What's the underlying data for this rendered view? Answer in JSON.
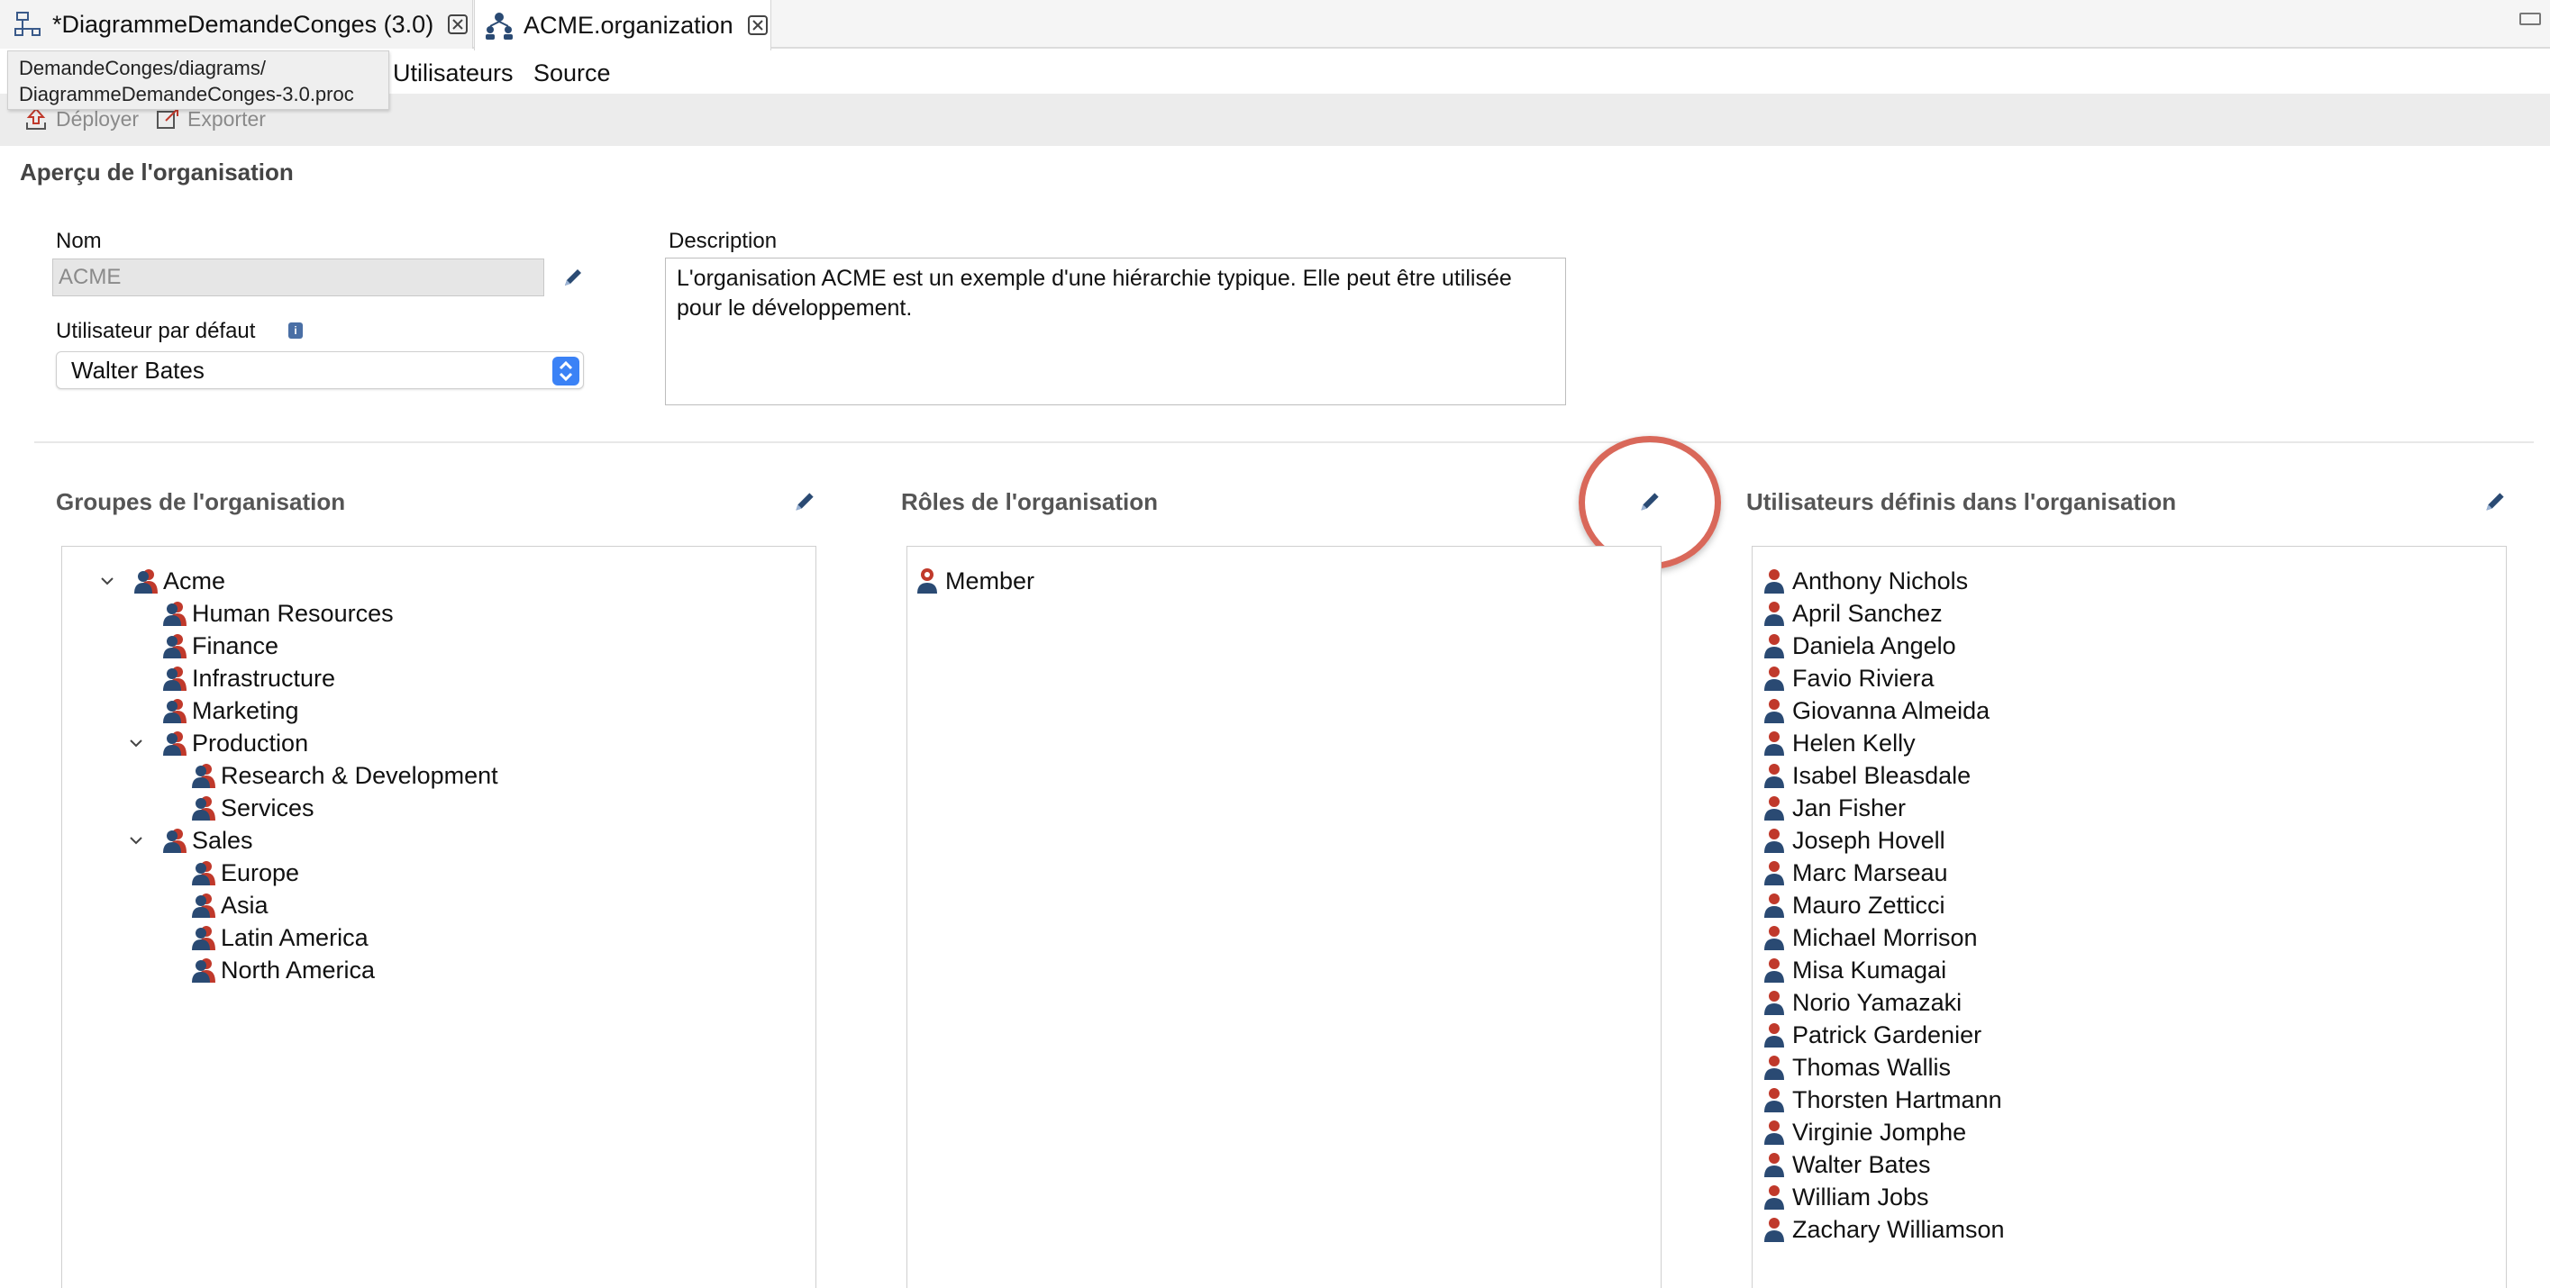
{
  "tabs": [
    {
      "label": "*DiagrammeDemandeConges (3.0)",
      "active": false
    },
    {
      "label": "ACME.organization",
      "active": true
    }
  ],
  "tooltip": {
    "line1": "DemandeConges/diagrams/",
    "line2": "DiagrammeDemandeConges-3.0.proc"
  },
  "subtabs": {
    "users": "Utilisateurs",
    "source": "Source"
  },
  "toolbar": {
    "deploy": "Déployer",
    "export": "Exporter"
  },
  "overview": {
    "title": "Aperçu de l'organisation",
    "name_label": "Nom",
    "name_value": "ACME",
    "default_user_label": "Utilisateur par défaut",
    "default_user_value": "Walter Bates",
    "description_label": "Description",
    "description_value": "L'organisation ACME est un exemple d'une hiérarchie typique. Elle peut être utilisée pour le développement."
  },
  "groups": {
    "title": "Groupes de l'organisation",
    "items": [
      {
        "label": "Acme",
        "level": 0,
        "expandable": true
      },
      {
        "label": "Human Resources",
        "level": 1,
        "expandable": false
      },
      {
        "label": "Finance",
        "level": 1,
        "expandable": false
      },
      {
        "label": "Infrastructure",
        "level": 1,
        "expandable": false
      },
      {
        "label": "Marketing",
        "level": 1,
        "expandable": false
      },
      {
        "label": "Production",
        "level": 1,
        "expandable": true
      },
      {
        "label": "Research & Development",
        "level": 2,
        "expandable": false
      },
      {
        "label": "Services",
        "level": 2,
        "expandable": false
      },
      {
        "label": "Sales",
        "level": 1,
        "expandable": true
      },
      {
        "label": "Europe",
        "level": 2,
        "expandable": false
      },
      {
        "label": "Asia",
        "level": 2,
        "expandable": false
      },
      {
        "label": "Latin America",
        "level": 2,
        "expandable": false
      },
      {
        "label": "North America",
        "level": 2,
        "expandable": false
      }
    ]
  },
  "roles": {
    "title": "Rôles de l'organisation",
    "items": [
      "Member"
    ]
  },
  "users": {
    "title": "Utilisateurs définis dans l'organisation",
    "items": [
      "Anthony Nichols",
      "April Sanchez",
      "Daniela Angelo",
      "Favio Riviera",
      "Giovanna Almeida",
      "Helen Kelly",
      "Isabel Bleasdale",
      "Jan Fisher",
      "Joseph Hovell",
      "Marc Marseau",
      "Mauro Zetticci",
      "Michael Morrison",
      "Misa Kumagai",
      "Norio Yamazaki",
      "Patrick Gardenier",
      "Thomas Wallis",
      "Thorsten Hartmann",
      "Virginie Jomphe",
      "Walter Bates",
      "William Jobs",
      "Zachary Williamson"
    ]
  },
  "colors": {
    "accent": "#3b82f6",
    "highlight": "#d9685a",
    "group_icon": "#2a4a73",
    "user_icon_head": "#c0392b"
  }
}
